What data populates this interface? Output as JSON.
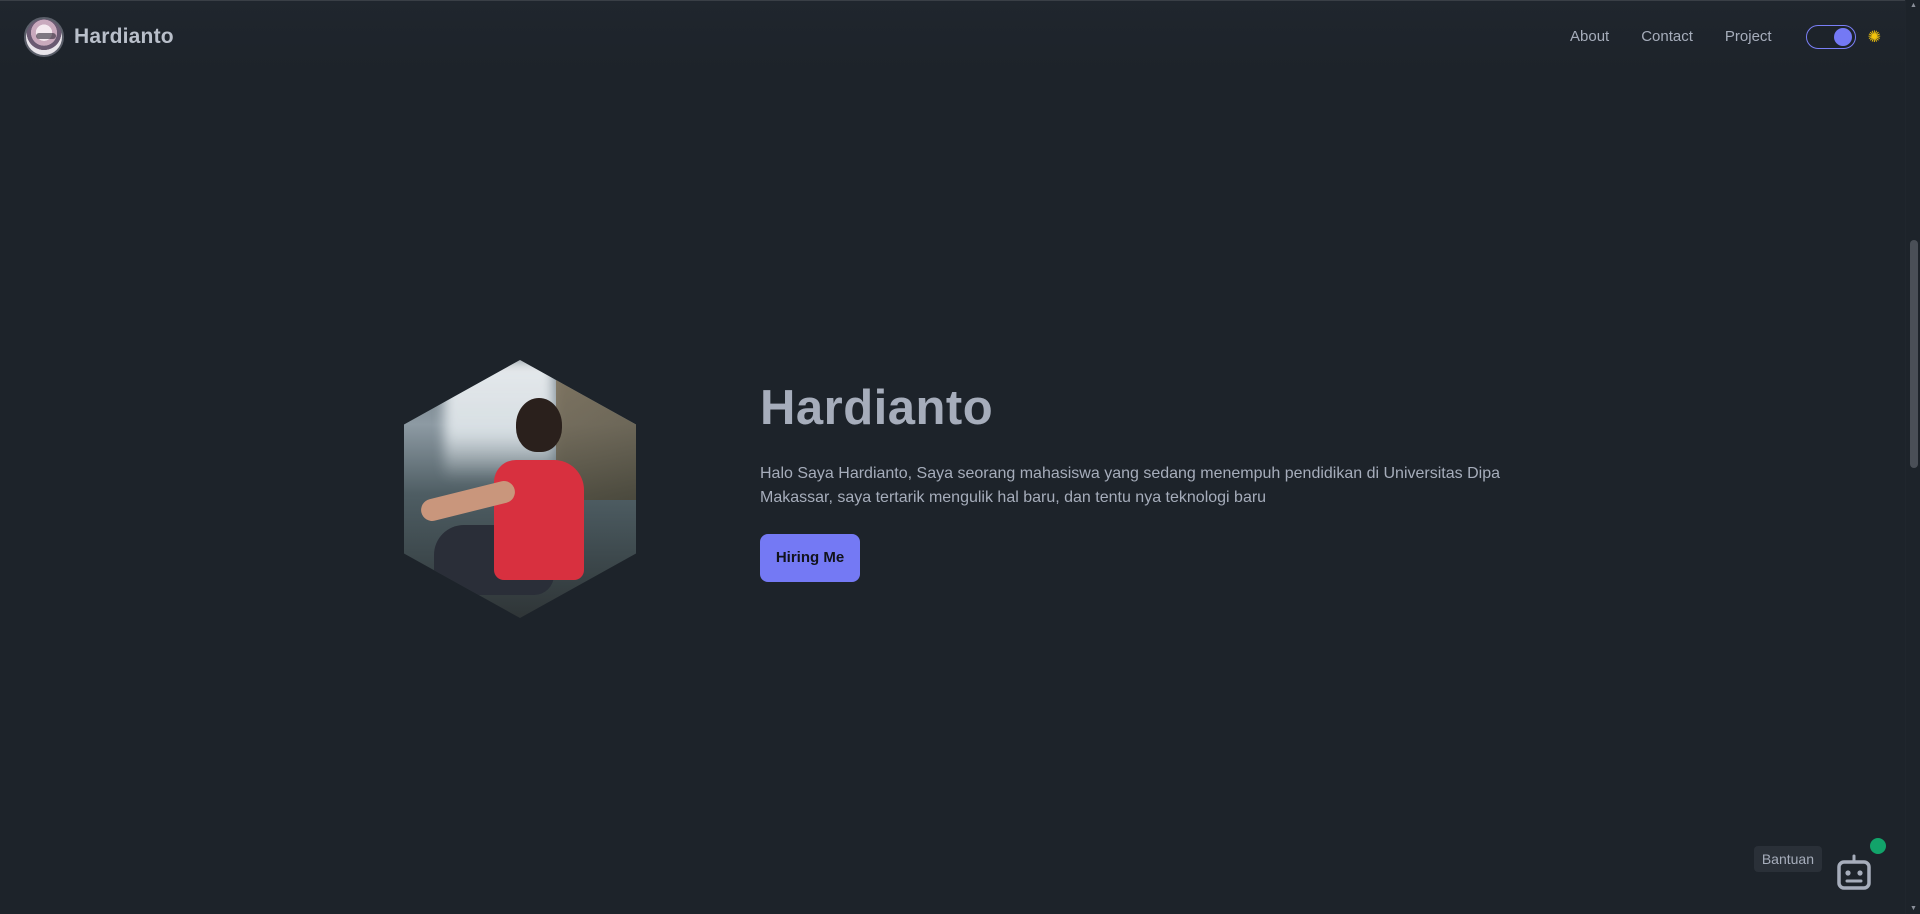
{
  "navbar": {
    "brand": "Hardianto",
    "links": [
      "About",
      "Contact",
      "Project"
    ],
    "theme_toggle": {
      "on": true
    },
    "icons": {
      "theme": "sun-icon",
      "avatar": "avatar-image"
    }
  },
  "hero": {
    "title": "Hardianto",
    "description": "Halo Saya Hardianto, Saya seorang mahasiswa yang sedang menempuh pendidikan di Universitas Dipa Makassar, saya tertarik mengulik hal baru, dan tentu nya teknologi baru",
    "cta": "Hiring Me"
  },
  "help": {
    "label": "Bantuan",
    "icon": "robot-icon"
  },
  "colors": {
    "background": "#1d232a",
    "accent": "#7479f4",
    "text": "#a6adbb",
    "status": "#12a36a"
  }
}
